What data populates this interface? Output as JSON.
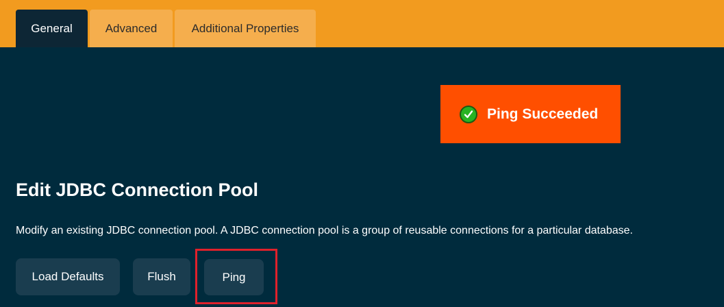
{
  "tabs": [
    {
      "label": "General",
      "active": true
    },
    {
      "label": "Advanced",
      "active": false
    },
    {
      "label": "Additional Properties",
      "active": false
    }
  ],
  "banner": {
    "text": "Ping Succeeded",
    "icon": "check-icon",
    "color": "#ff4f00"
  },
  "page": {
    "title": "Edit JDBC Connection Pool",
    "description": "Modify an existing JDBC connection pool. A JDBC connection pool is a group of reusable connections for a particular database."
  },
  "buttons": {
    "load_defaults": "Load Defaults",
    "flush": "Flush",
    "ping": "Ping"
  },
  "colors": {
    "tab_bar": "#f29b1f",
    "background": "#002b3d",
    "highlight": "#e0212b"
  }
}
